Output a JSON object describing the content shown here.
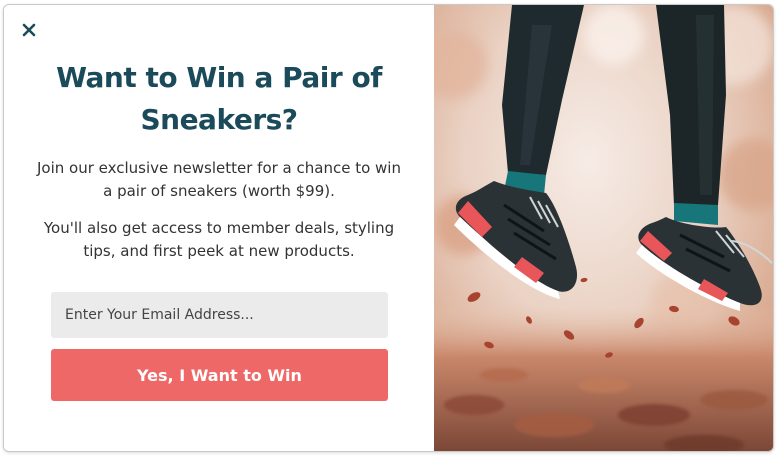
{
  "popup": {
    "close_icon": "close-icon",
    "title": "Want to Win a Pair of Sneakers?",
    "description": "Join our exclusive newsletter for a chance to win a pair of sneakers (worth $99).",
    "benefits": "You'll also get access to member deals, styling tips, and first peek at new products.",
    "email_placeholder": "Enter Your Email Address...",
    "email_value": "",
    "cta_label": "Yes, I Want to Win",
    "image": "sneakers-autumn-leaves-photo"
  },
  "colors": {
    "title": "#1b4b5a",
    "body_text": "#333333",
    "input_bg": "#ebebeb",
    "cta_bg": "#ef6868",
    "cta_text": "#ffffff"
  }
}
